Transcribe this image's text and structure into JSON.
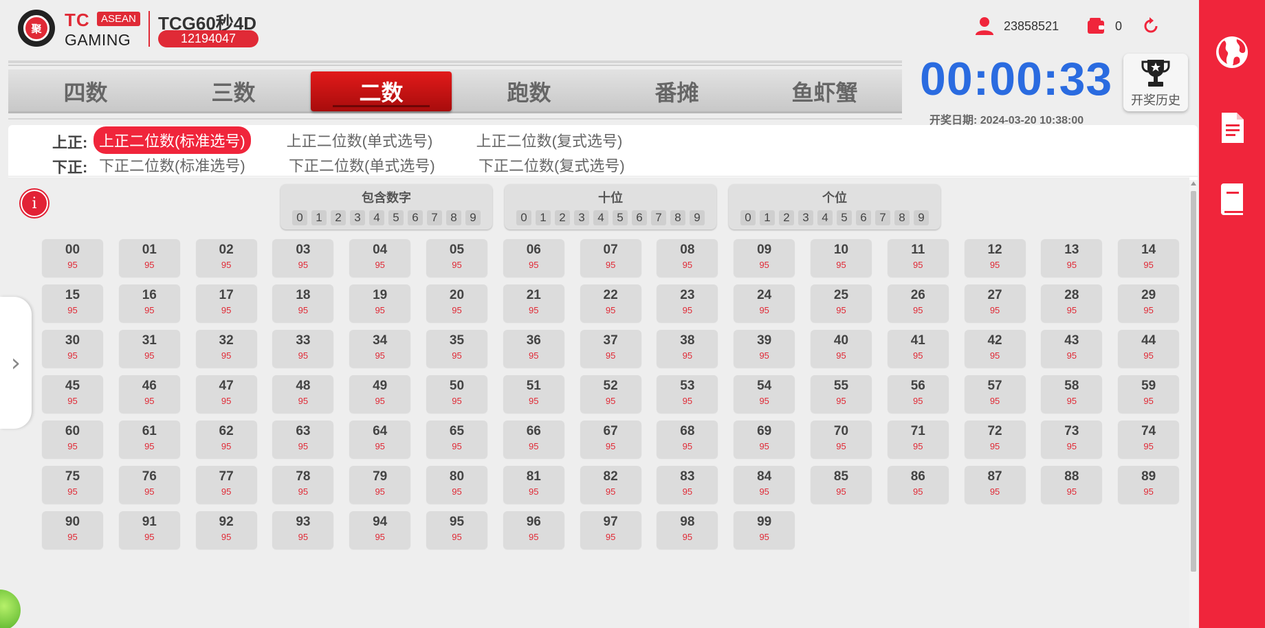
{
  "header": {
    "logo_glyph": "聚",
    "brand_tc": "TC",
    "brand_asean": "ASEAN",
    "brand_gaming": "GAMING",
    "game_title": "TCG60秒4D",
    "draw_id": "12194047",
    "user_id": "23858521",
    "balance": "0",
    "icons": {
      "user": "user-icon",
      "wallet": "wallet-icon",
      "refresh": "refresh-icon"
    }
  },
  "tabs": [
    {
      "label": "四数",
      "active": false
    },
    {
      "label": "三数",
      "active": false
    },
    {
      "label": "二数",
      "active": true
    },
    {
      "label": "跑数",
      "active": false
    },
    {
      "label": "番摊",
      "active": false
    },
    {
      "label": "鱼虾蟹",
      "active": false
    }
  ],
  "timer": {
    "countdown": "00:00:33",
    "draw_date": "开奖日期: 2024-03-20 10:38:00",
    "history_label": "开奖历史"
  },
  "subnav": {
    "upper_label": "上正:",
    "upper_options": [
      "上正二位数(标准选号)",
      "上正二位数(单式选号)",
      "上正二位数(复式选号)"
    ],
    "upper_active_index": 0,
    "lower_label": "下正:",
    "lower_options": [
      "下正二位数(标准选号)",
      "下正二位数(单式选号)",
      "下正二位数(复式选号)"
    ]
  },
  "filters": [
    {
      "title": "包含数字",
      "digits": [
        "0",
        "1",
        "2",
        "3",
        "4",
        "5",
        "6",
        "7",
        "8",
        "9"
      ]
    },
    {
      "title": "十位",
      "digits": [
        "0",
        "1",
        "2",
        "3",
        "4",
        "5",
        "6",
        "7",
        "8",
        "9"
      ]
    },
    {
      "title": "个位",
      "digits": [
        "0",
        "1",
        "2",
        "3",
        "4",
        "5",
        "6",
        "7",
        "8",
        "9"
      ]
    }
  ],
  "numbers": {
    "odds": "95",
    "items": [
      "00",
      "01",
      "02",
      "03",
      "04",
      "05",
      "06",
      "07",
      "08",
      "09",
      "10",
      "11",
      "12",
      "13",
      "14",
      "15",
      "16",
      "17",
      "18",
      "19",
      "20",
      "21",
      "22",
      "23",
      "24",
      "25",
      "26",
      "27",
      "28",
      "29",
      "30",
      "31",
      "32",
      "33",
      "34",
      "35",
      "36",
      "37",
      "38",
      "39",
      "40",
      "41",
      "42",
      "43",
      "44",
      "45",
      "46",
      "47",
      "48",
      "49",
      "50",
      "51",
      "52",
      "53",
      "54",
      "55",
      "56",
      "57",
      "58",
      "59",
      "60",
      "61",
      "62",
      "63",
      "64",
      "65",
      "66",
      "67",
      "68",
      "69",
      "70",
      "71",
      "72",
      "73",
      "74",
      "75",
      "76",
      "77",
      "78",
      "79",
      "80",
      "81",
      "82",
      "83",
      "84",
      "85",
      "86",
      "87",
      "88",
      "89",
      "90",
      "91",
      "92",
      "93",
      "94",
      "95",
      "96",
      "97",
      "98",
      "99"
    ]
  },
  "info_glyph": "i",
  "side_handle_glyph": "›",
  "colors": {
    "brand_red": "#f0253b",
    "timer_blue": "#2a6be0",
    "odds_red": "#e02a36"
  }
}
